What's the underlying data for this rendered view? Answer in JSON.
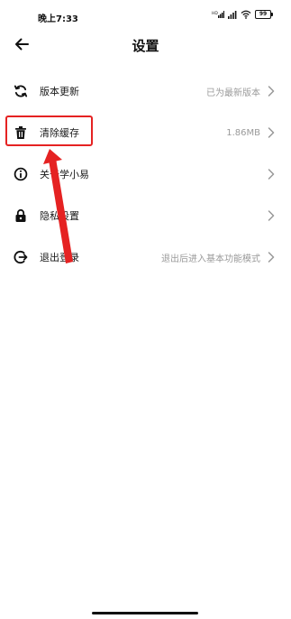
{
  "status_bar": {
    "time": "晚上7:33",
    "battery": "99",
    "icons": [
      "hd-signal-icon",
      "signal-icon",
      "wifi-icon",
      "battery-icon"
    ]
  },
  "nav": {
    "title": "设置",
    "back_icon": "back-arrow-icon"
  },
  "settings": {
    "items": [
      {
        "icon": "refresh-icon",
        "label": "版本更新",
        "value": "已为最新版本"
      },
      {
        "icon": "trash-icon",
        "label": "清除缓存",
        "value": "1.86MB"
      },
      {
        "icon": "info-icon",
        "label": "关于学小易",
        "value": ""
      },
      {
        "icon": "lock-icon",
        "label": "隐私设置",
        "value": ""
      },
      {
        "icon": "logout-icon",
        "label": "退出登录",
        "value": "退出后进入基本功能模式"
      }
    ]
  },
  "annotation": {
    "color": "#e52222",
    "highlighted_item": "清除缓存"
  }
}
